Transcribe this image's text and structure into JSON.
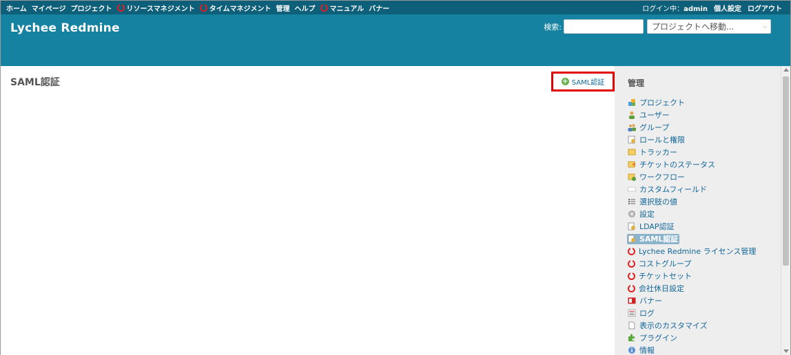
{
  "top_menu": {
    "items": [
      {
        "label": "ホーム",
        "icon": null
      },
      {
        "label": "マイページ",
        "icon": null
      },
      {
        "label": "プロジェクト",
        "icon": null
      },
      {
        "label": "リソースマネジメント",
        "icon": "lychee-icon"
      },
      {
        "label": "タイムマネジメント",
        "icon": "lychee-icon"
      },
      {
        "label": "管理",
        "icon": null
      },
      {
        "label": "ヘルプ",
        "icon": null
      },
      {
        "label": "マニュアル",
        "icon": "lychee-icon"
      },
      {
        "label": "バナー",
        "icon": null
      }
    ],
    "logged_as_label": "ログイン中：",
    "user": "admin",
    "my_account": "個人設定",
    "logout": "ログアウト"
  },
  "header": {
    "title": "Lychee Redmine",
    "search_label": "検索:",
    "search_value": "",
    "project_jump": "プロジェクトへ移動..."
  },
  "content": {
    "title": "SAML認証",
    "action_label": "SAML認証",
    "action_highlight_color": "#e00000"
  },
  "sidebar": {
    "title": "管理",
    "items": [
      {
        "label": "プロジェクト",
        "icon": "projects-icon",
        "selected": false
      },
      {
        "label": "ユーザー",
        "icon": "user-icon",
        "selected": false
      },
      {
        "label": "グループ",
        "icon": "group-icon",
        "selected": false
      },
      {
        "label": "ロールと権限",
        "icon": "roles-icon",
        "selected": false
      },
      {
        "label": "トラッカー",
        "icon": "tracker-icon",
        "selected": false
      },
      {
        "label": "チケットのステータス",
        "icon": "issue-status-icon",
        "selected": false
      },
      {
        "label": "ワークフロー",
        "icon": "workflow-icon",
        "selected": false
      },
      {
        "label": "カスタムフィールド",
        "icon": "custom-field-icon",
        "selected": false
      },
      {
        "label": "選択肢の値",
        "icon": "list-icon",
        "selected": false
      },
      {
        "label": "設定",
        "icon": "gear-icon",
        "selected": false
      },
      {
        "label": "LDAP認証",
        "icon": "ldap-icon",
        "selected": false
      },
      {
        "label": "SAML認証",
        "icon": "saml-icon",
        "selected": true
      },
      {
        "label": "Lychee Redmine ライセンス管理",
        "icon": "lychee-icon",
        "selected": false
      },
      {
        "label": "コストグループ",
        "icon": "lychee-icon",
        "selected": false
      },
      {
        "label": "チケットセット",
        "icon": "lychee-icon",
        "selected": false
      },
      {
        "label": "会社休日設定",
        "icon": "lychee-icon",
        "selected": false
      },
      {
        "label": "バナー",
        "icon": "banner-icon",
        "selected": false
      },
      {
        "label": "ログ",
        "icon": "log-icon",
        "selected": false
      },
      {
        "label": "表示のカスタマイズ",
        "icon": "document-icon",
        "selected": false
      },
      {
        "label": "プラグイン",
        "icon": "plugin-icon",
        "selected": false
      },
      {
        "label": "情報",
        "icon": "info-icon",
        "selected": false
      }
    ]
  },
  "colors": {
    "top_menu_bg": "#0e5f79",
    "header_bg": "#1682a1",
    "sidebar_bg": "#eeeeee",
    "link": "#116699",
    "selected_bg": "#8ab3cc"
  }
}
